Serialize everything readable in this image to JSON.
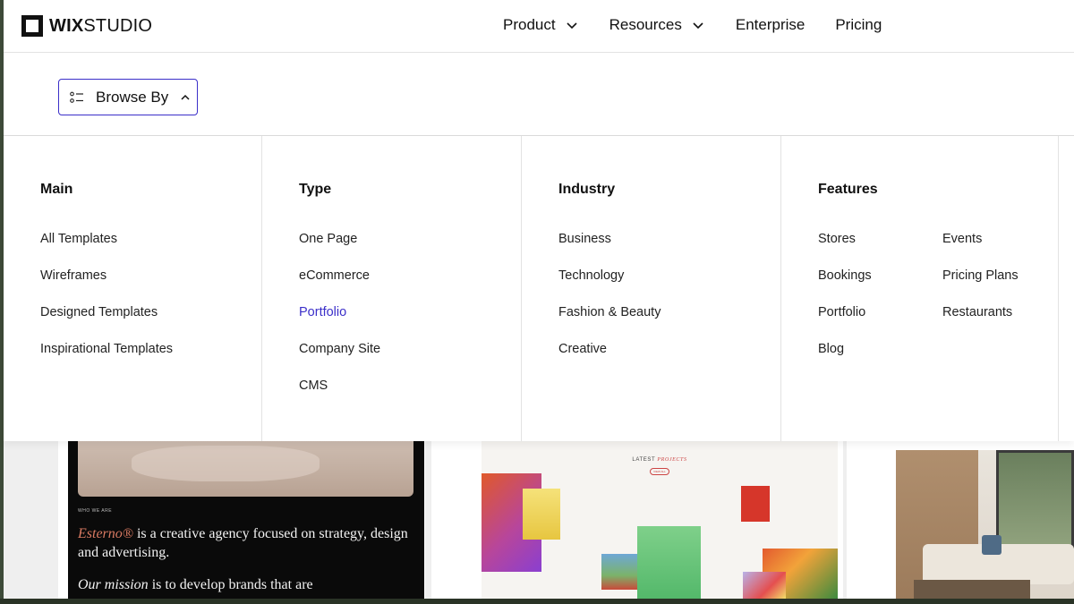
{
  "header": {
    "logo": {
      "bold": "WIX",
      "light": "STUDIO"
    },
    "nav": [
      {
        "label": "Product",
        "has_dropdown": true
      },
      {
        "label": "Resources",
        "has_dropdown": true
      },
      {
        "label": "Enterprise",
        "has_dropdown": false
      },
      {
        "label": "Pricing",
        "has_dropdown": false
      }
    ]
  },
  "browse": {
    "label": "Browse By",
    "expanded": true
  },
  "menu": {
    "main": {
      "title": "Main",
      "items": [
        "All Templates",
        "Wireframes",
        "Designed Templates",
        "Inspirational Templates"
      ]
    },
    "type": {
      "title": "Type",
      "items": [
        "One Page",
        "eCommerce",
        "Portfolio",
        "Company Site",
        "CMS"
      ],
      "active": "Portfolio"
    },
    "industry": {
      "title": "Industry",
      "items": [
        "Business",
        "Technology",
        "Fashion & Beauty",
        "Creative"
      ]
    },
    "features": {
      "title": "Features",
      "items_col1": [
        "Stores",
        "Bookings",
        "Portfolio",
        "Blog"
      ],
      "items_col2": [
        "Events",
        "Pricing Plans",
        "Restaurants"
      ]
    }
  },
  "previews": {
    "card1": {
      "small_label": "WHO WE ARE",
      "line1_italic": "Esterno®",
      "line1_rest": " is a creative agency focused on strategy, design and advertising.",
      "line2_italic": "Our mission",
      "line2_rest": " is to develop brands that are"
    },
    "card2": {
      "title_plain": "LATEST ",
      "title_italic": "PROJECTS",
      "pill": "VIEW ALL"
    }
  },
  "colors": {
    "accent": "#3b2fc9",
    "text": "#111111"
  }
}
